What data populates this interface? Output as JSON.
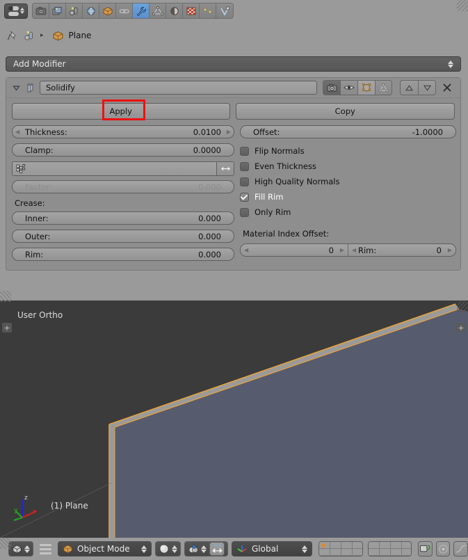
{
  "window": {
    "app": "Blender",
    "editor_type": "properties-editor"
  },
  "properties_tabs": [
    {
      "name": "render-tab",
      "icon": "camera-icon",
      "active": false
    },
    {
      "name": "render-layers-tab",
      "icon": "images-icon",
      "active": false
    },
    {
      "name": "scene-tab",
      "icon": "scene-icon",
      "active": false
    },
    {
      "name": "world-tab",
      "icon": "world-globe-icon",
      "active": false
    },
    {
      "name": "object-tab",
      "icon": "cube-icon",
      "active": false
    },
    {
      "name": "constraints-tab",
      "icon": "chain-link-icon",
      "active": false
    },
    {
      "name": "modifiers-tab",
      "icon": "wrench-icon",
      "active": true
    },
    {
      "name": "object-data-tab",
      "icon": "mesh-data-icon",
      "active": false
    },
    {
      "name": "material-tab",
      "icon": "material-sphere-icon",
      "active": false
    },
    {
      "name": "texture-tab",
      "icon": "checker-texture-icon",
      "active": false
    },
    {
      "name": "particles-tab",
      "icon": "particles-icon",
      "active": false
    },
    {
      "name": "physics-tab",
      "icon": "physics-icon",
      "active": false
    }
  ],
  "breadcrumb": {
    "pin_icon": "pin-icon",
    "browse_icon": "browse-data-icon",
    "separator": "▸",
    "object_icon": "cube-icon",
    "object_name": "Plane"
  },
  "add_modifier": {
    "label": "Add Modifier"
  },
  "modifier": {
    "expand_icon": "triangle-down-icon",
    "type_icon": "solidify-modifier-icon",
    "name": "Solidify",
    "header_toggles": [
      {
        "name": "render-toggle",
        "icon": "camera-icon",
        "active": true
      },
      {
        "name": "realtime-toggle",
        "icon": "eye-icon",
        "active": false
      },
      {
        "name": "edit-mode-toggle",
        "icon": "edit-mode-icon",
        "active": true
      },
      {
        "name": "on-cage-toggle",
        "icon": "on-cage-icon",
        "active": false
      }
    ],
    "move_up": "△",
    "move_down": "▽",
    "close_icon": "close-x-icon",
    "apply_label": "Apply",
    "copy_label": "Copy",
    "highlight_color": "#ee1111",
    "left_column": {
      "thickness": {
        "label": "Thickness:",
        "value": "0.0100"
      },
      "clamp": {
        "label": "Clamp:",
        "value": "0.0000"
      },
      "vertex_group": {
        "icon": "vertex-group-icon",
        "value": "",
        "invert_icon": "arrows-left-right-icon"
      },
      "factor": {
        "label": "Factor:",
        "value": "0.000",
        "disabled": true
      },
      "crease_header": "Crease:",
      "inner": {
        "label": "Inner:",
        "value": "0.000"
      },
      "outer": {
        "label": "Outer:",
        "value": "0.000"
      },
      "rim": {
        "label": "Rim:",
        "value": "0.000"
      }
    },
    "right_column": {
      "offset": {
        "label": "Offset:",
        "value": "-1.0000"
      },
      "checkboxes": [
        {
          "label": "Flip Normals",
          "checked": false
        },
        {
          "label": "Even Thickness",
          "checked": false
        },
        {
          "label": "High Quality Normals",
          "checked": false
        },
        {
          "label": "Fill Rim",
          "checked": true
        },
        {
          "label": "Only Rim",
          "checked": false
        }
      ],
      "material_index_header": "Material Index Offset:",
      "mat_offset": {
        "label": "",
        "value": "0"
      },
      "mat_rim": {
        "label": "Rim:",
        "value": "0"
      }
    }
  },
  "viewport": {
    "view_label": "User Ortho",
    "object_label": "(1) Plane",
    "axis_gizmo": {
      "x": "x",
      "y": "y",
      "z": "z",
      "x_color": "#cc2222",
      "y_color": "#22aa22",
      "z_color": "#2222cc"
    },
    "object_face_color": "#575b6e",
    "object_side_color": "#9a9a9a",
    "outline_color": "#e8a33d",
    "background_color": "#3b3b3b",
    "plus_handle": "+"
  },
  "bottom_bar": {
    "editor_icon": "3d-view-editor-icon",
    "menu_icon": "hamburger-menu-icon",
    "mode": {
      "icon": "cube-icon",
      "label": "Object Mode"
    },
    "shading": {
      "icon": "solid-shading-icon"
    },
    "pivot": {
      "icon": "pivot-median-point-icon"
    },
    "snap": {
      "icon": "snap-magnet-icon"
    },
    "orientation": {
      "icon": "transform-axes-icon",
      "label": "Global"
    },
    "layers": {
      "group_a": [
        true,
        false,
        false,
        false,
        false,
        false,
        false,
        false,
        false,
        false
      ],
      "group_b": [
        false,
        false,
        false,
        false,
        false,
        false,
        false,
        false,
        false,
        false
      ],
      "active_color": "#e08a2a"
    },
    "right_buttons": [
      {
        "name": "lock-object-modes-button",
        "icon": "lock-icon"
      },
      {
        "name": "proportional-edit-button",
        "icon": "proportional-edit-icon"
      },
      {
        "name": "proportional-falloff-button",
        "icon": "smooth-falloff-icon"
      }
    ]
  }
}
